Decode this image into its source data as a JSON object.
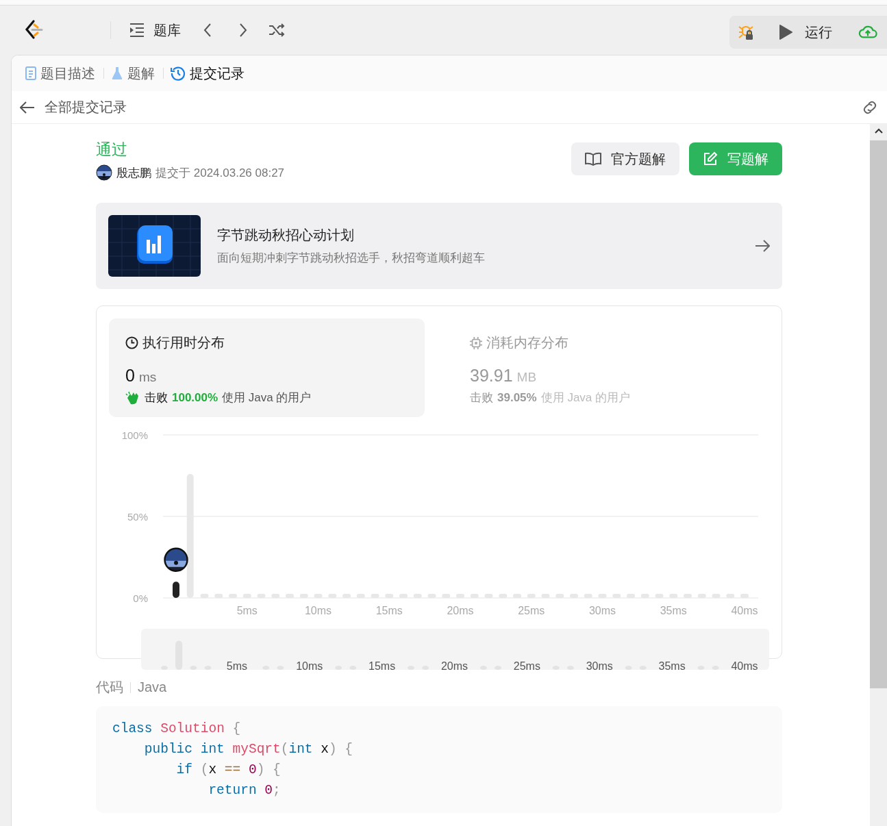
{
  "toolbar": {
    "menu_label": "题库",
    "run_label": "运行"
  },
  "tabs": [
    {
      "label": "题目描述",
      "selected": false
    },
    {
      "label": "题解",
      "selected": false
    },
    {
      "label": "提交记录",
      "selected": true
    }
  ],
  "back_label": "全部提交记录",
  "submission": {
    "status": "通过",
    "user": "殷志鹏",
    "submitted_at": "提交于 2024.03.26 08:27"
  },
  "actions": [
    {
      "label": "官方题解",
      "kind": "secondary"
    },
    {
      "label": "写题解",
      "kind": "primary"
    }
  ],
  "promo": {
    "kind": "picture",
    "title": "字节跳动秋招心动计划",
    "subtitle": "面向短期冲刺字节跳动秋招选手，秋招弯道顺利超车"
  },
  "stats": [
    {
      "kind": "time",
      "title": "执行用时分布",
      "value": "0",
      "unit": "ms",
      "beats_prefix": "击败",
      "beats": "100.00%",
      "beats_suffix": "使用 Java 的用户",
      "selected": true
    },
    {
      "kind": "memory",
      "title": "消耗内存分布",
      "value": "39.91",
      "unit": "MB",
      "beats_prefix": "击败",
      "beats": "39.05%",
      "beats_suffix": "使用 Java 的用户",
      "selected": false
    }
  ],
  "chart_data": {
    "type": "bar",
    "x": [
      0,
      1,
      2,
      3,
      4,
      5,
      6,
      7,
      8,
      9,
      10,
      11,
      12,
      13,
      14,
      15,
      16,
      17,
      18,
      19,
      20,
      21,
      22,
      23,
      24,
      25,
      26,
      27,
      28,
      29,
      30,
      31,
      32,
      33,
      34,
      35,
      36,
      37,
      38,
      39,
      40
    ],
    "series": [
      {
        "color": "#e8e8e8",
        "values": [
          null,
          76,
          0,
          0,
          0,
          0,
          0,
          0,
          0,
          0,
          0,
          0,
          0,
          0,
          0,
          0,
          0,
          0,
          0,
          0,
          0,
          0,
          0,
          0,
          0,
          0,
          0,
          0,
          0,
          0,
          0,
          0,
          0,
          0,
          0,
          0,
          0,
          0,
          0,
          0,
          0
        ]
      },
      {
        "color": "#222222",
        "values": [
          10,
          null,
          null,
          null,
          null,
          null,
          null,
          null,
          null,
          null,
          null,
          null,
          null,
          null,
          null,
          null,
          null,
          null,
          null,
          null,
          null,
          null,
          null,
          null,
          null,
          null,
          null,
          null,
          null,
          null,
          null,
          null,
          null,
          null,
          null,
          null,
          null,
          null,
          null,
          null,
          null
        ]
      }
    ],
    "ylim": [
      0,
      100
    ],
    "xlim": [
      0,
      40
    ],
    "yticks": [
      {
        "value": 0,
        "label": "0%"
      },
      {
        "value": 50,
        "label": "50%"
      },
      {
        "value": 100,
        "label": "100%"
      }
    ],
    "xticks": [
      {
        "value": 5,
        "label": "5ms"
      },
      {
        "value": 10,
        "label": "10ms"
      },
      {
        "value": 15,
        "label": "15ms"
      },
      {
        "value": 20,
        "label": "20ms"
      },
      {
        "value": 25,
        "label": "25ms"
      },
      {
        "value": 30,
        "label": "30ms"
      },
      {
        "value": 35,
        "label": "35ms"
      },
      {
        "value": 40,
        "label": "40ms"
      }
    ]
  },
  "overview_labels": [
    "5ms",
    "10ms",
    "15ms",
    "20ms",
    "25ms",
    "30ms",
    "35ms",
    "40ms"
  ],
  "code": {
    "label": "代码",
    "language": "Java",
    "lines": [
      [
        {
          "keyword": "class"
        },
        {
          "name": " Solution"
        },
        {
          "punct": " {"
        }
      ],
      [
        {
          "keyword": "    public int"
        },
        {
          "name": " mySqrt"
        },
        {
          "punct": "("
        },
        {
          "keyword": "int"
        },
        {
          "ident": " x"
        },
        {
          "punct": ") {"
        }
      ],
      [
        {
          "keyword": "        if"
        },
        {
          "punct": " ("
        },
        {
          "ident": "x"
        },
        {
          "operator": " =="
        },
        {
          "number": " 0"
        },
        {
          "punct": ") {"
        }
      ],
      [
        {
          "keyword": "            return"
        },
        {
          "number": " 0"
        },
        {
          "punct": ";"
        }
      ]
    ]
  }
}
